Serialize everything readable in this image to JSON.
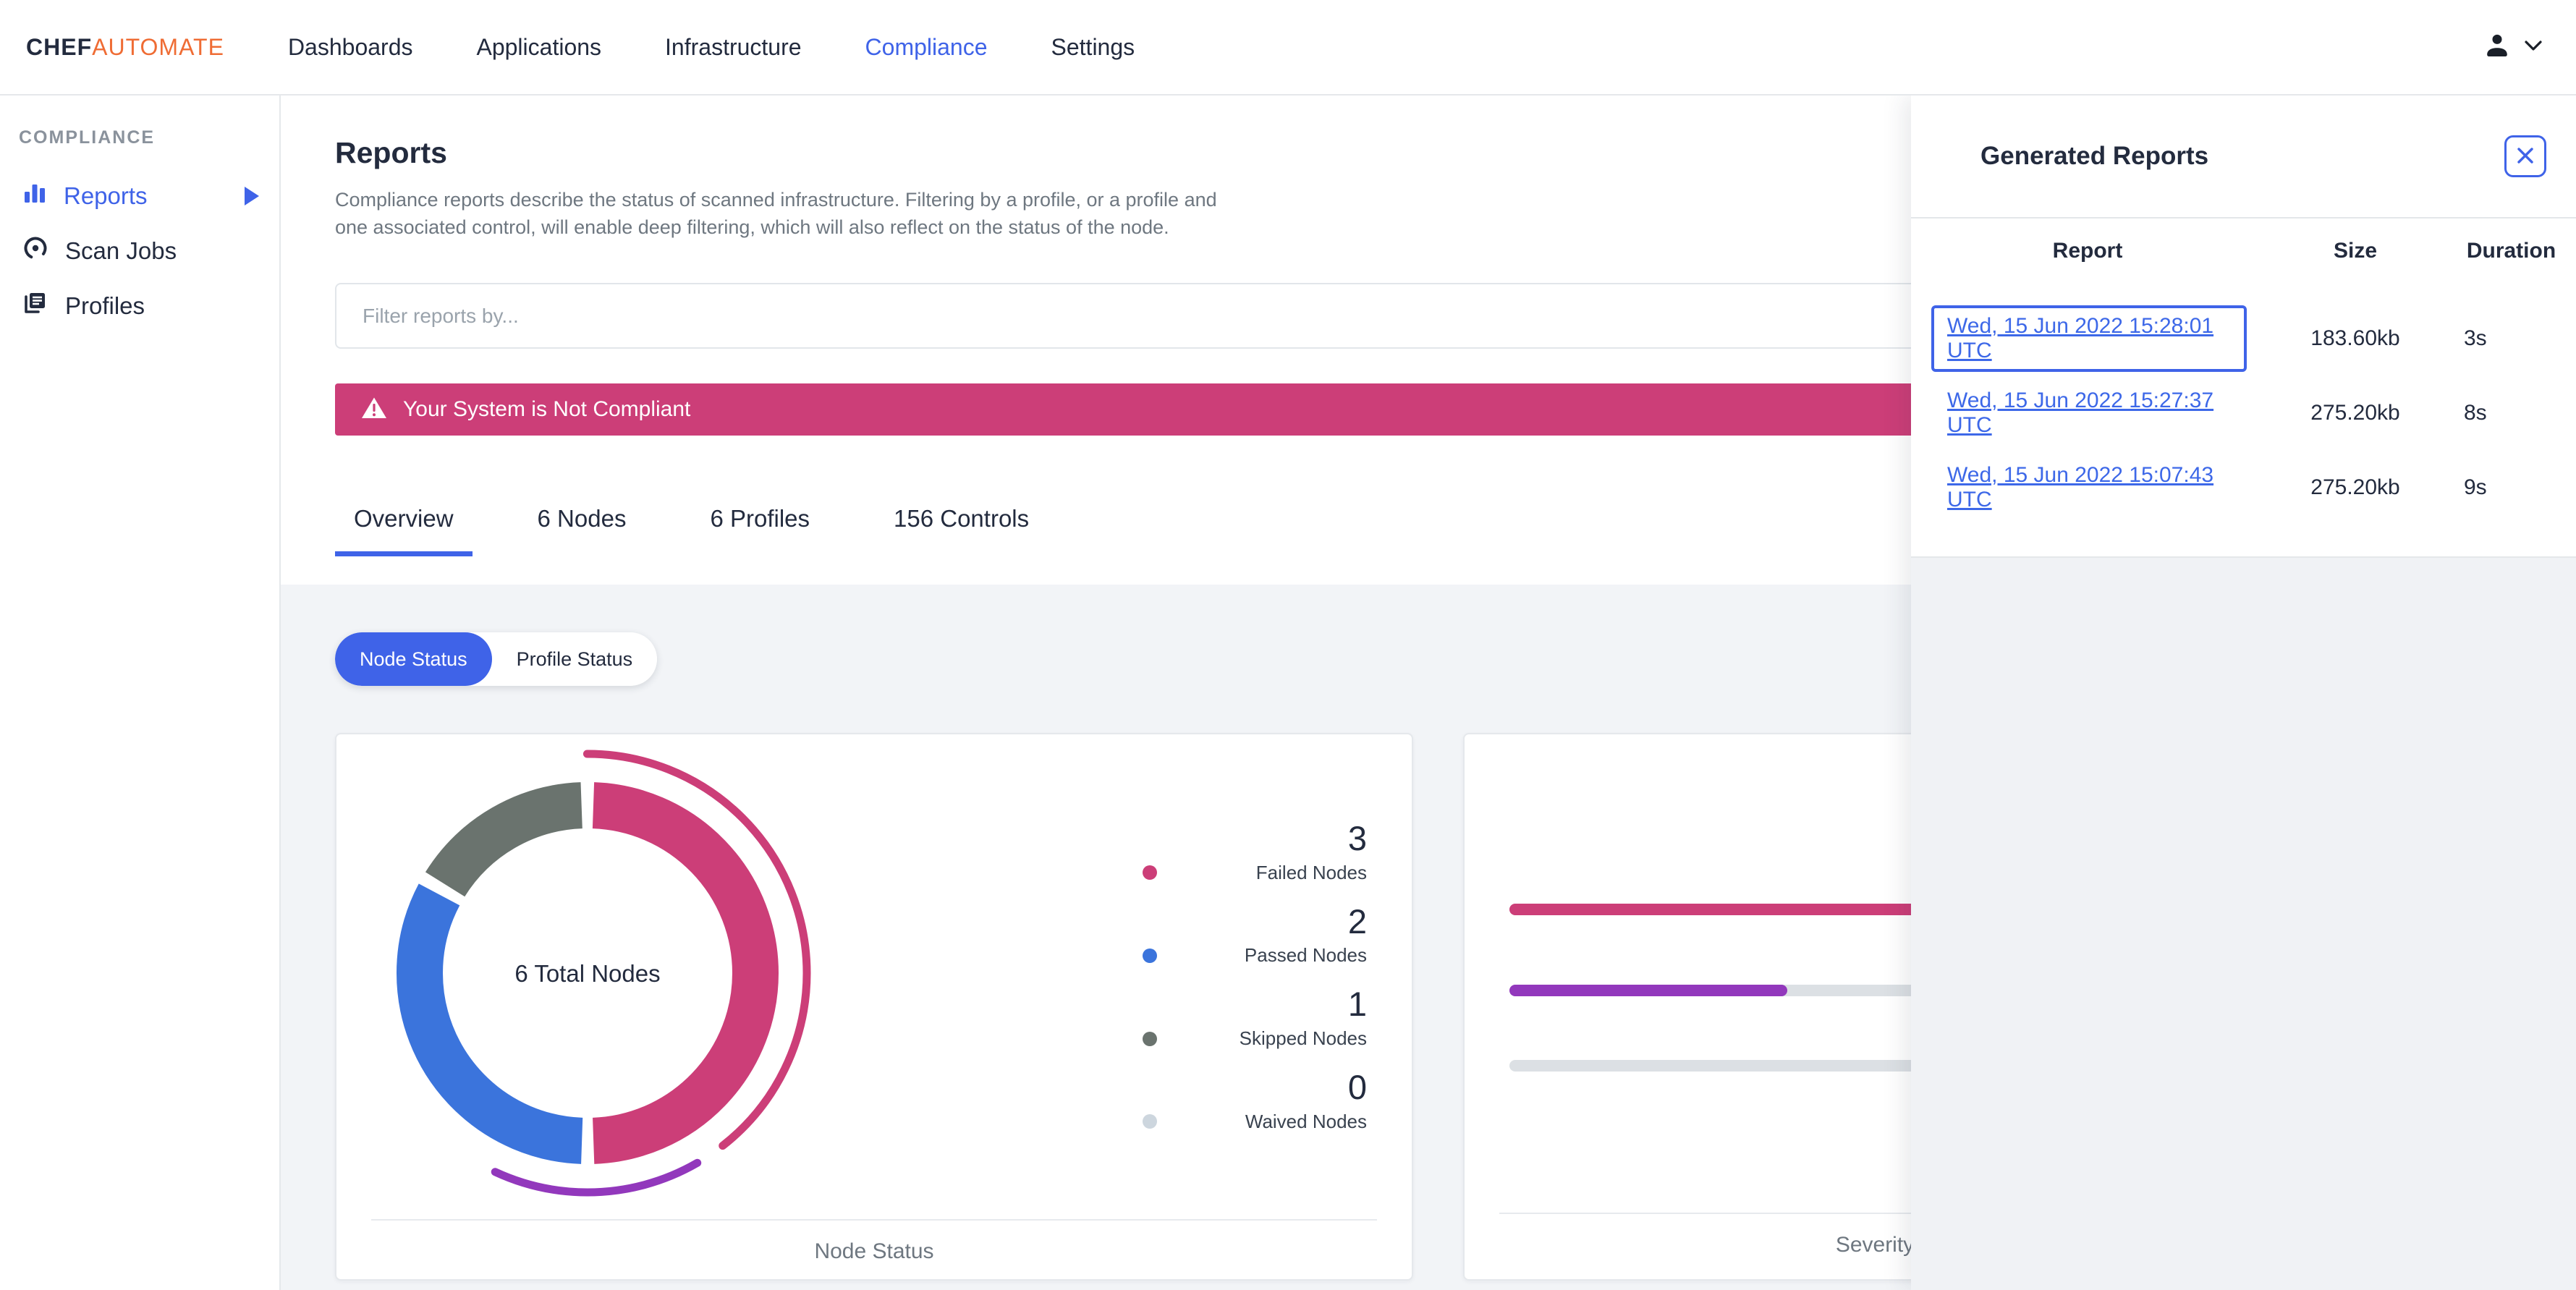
{
  "brand": {
    "chef": "CHEF",
    "automate": "AUTOMATE"
  },
  "nav": {
    "items": [
      "Dashboards",
      "Applications",
      "Infrastructure",
      "Compliance",
      "Settings"
    ],
    "active": "Compliance"
  },
  "sidebar": {
    "section_label": "COMPLIANCE",
    "items": [
      "Reports",
      "Scan Jobs",
      "Profiles"
    ],
    "active": "Reports"
  },
  "page": {
    "title": "Reports",
    "description": "Compliance reports describe the status of scanned infrastructure. Filtering by a profile, or a profile and one associated control, will enable deep filtering, which will also reflect on the status of the node."
  },
  "filter": {
    "placeholder": "Filter reports by..."
  },
  "banner": {
    "text": "Your System is Not Compliant",
    "color": "#CC3E78"
  },
  "tabs": [
    "Overview",
    "6 Nodes",
    "6 Profiles",
    "156 Controls"
  ],
  "active_tab": "Overview",
  "toggle": {
    "options": [
      "Node Status",
      "Profile Status"
    ],
    "active": "Node Status"
  },
  "drawer": {
    "title": "Generated Reports",
    "columns": [
      "Report",
      "Size",
      "Duration"
    ],
    "rows": [
      {
        "report": "Wed, 15 Jun 2022 15:28:01 UTC",
        "size": "183.60kb",
        "duration": "3s",
        "focused": true
      },
      {
        "report": "Wed, 15 Jun 2022 15:27:37 UTC",
        "size": "275.20kb",
        "duration": "8s",
        "focused": false
      },
      {
        "report": "Wed, 15 Jun 2022 15:07:43 UTC",
        "size": "275.20kb",
        "duration": "9s",
        "focused": false
      }
    ]
  },
  "chart_data": [
    {
      "type": "pie",
      "title": "Node Status",
      "center_label": "6 Total Nodes",
      "total": 6,
      "legend_position": "right",
      "slices": [
        {
          "label": "Failed Nodes",
          "value": 3,
          "color": "#CC3E78"
        },
        {
          "label": "Passed Nodes",
          "value": 2,
          "color": "#3B74DC"
        },
        {
          "label": "Skipped Nodes",
          "value": 1,
          "color": "#6A736E"
        },
        {
          "label": "Waived Nodes",
          "value": 0,
          "color": "#CDD6DE"
        }
      ],
      "outer_arcs": [
        {
          "color": "#CC3E78",
          "start_deg": 0,
          "sweep_deg": 142
        },
        {
          "color": "#9238BC",
          "start_deg": 150,
          "sweep_deg": 55
        }
      ]
    },
    {
      "type": "bar",
      "title": "Severity",
      "orientation": "horizontal",
      "bars": [
        {
          "color": "#CC3E78",
          "fill_percent": 100
        },
        {
          "color": "#9238BC",
          "fill_percent": 38
        },
        {
          "color": "#DCE0E4",
          "fill_percent": 0
        }
      ]
    }
  ],
  "colors": {
    "primary_blue": "#3F63E8",
    "link_blue": "#3D68E8",
    "failed_pink": "#CC3E78",
    "passed_blue": "#3B74DC",
    "skipped_gray": "#6A736E",
    "waived_gray": "#CDD6DE",
    "purple": "#9238BC",
    "brand_orange": "#EF6C34",
    "bar_track": "#DCE0E4"
  }
}
